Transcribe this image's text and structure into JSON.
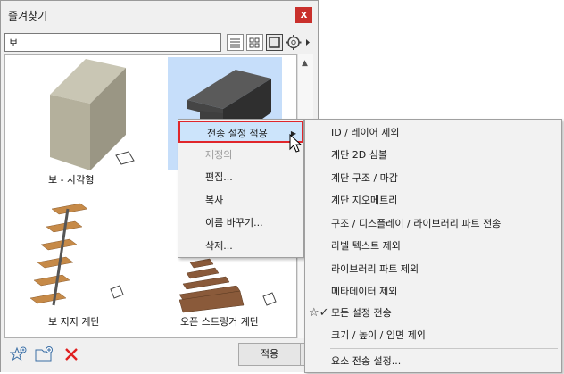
{
  "palette": {
    "title": "즐겨찾기",
    "close_label": "x",
    "search_value": "보",
    "apply_label": "적용",
    "items": [
      {
        "label": "보 - 사각형"
      },
      {
        "label": ""
      },
      {
        "label": "보 지지 계단"
      },
      {
        "label": "오픈 스트링거 계단"
      }
    ]
  },
  "context_menu": {
    "items": [
      {
        "label": "전송 설정 적용",
        "state": "highlighted",
        "submenu": true
      },
      {
        "label": "재정의",
        "state": "disabled"
      },
      {
        "label": "편집..."
      },
      {
        "label": "복사"
      },
      {
        "label": "이름 바꾸기..."
      },
      {
        "label": "삭제..."
      }
    ]
  },
  "submenu": {
    "items": [
      {
        "label": "ID / 레이어 제외"
      },
      {
        "label": "계단 2D 심볼"
      },
      {
        "label": "계단 구조 / 마감"
      },
      {
        "label": "계단 지오메트리"
      },
      {
        "label": "구조 / 디스플레이 / 라이브러리 파트 전송"
      },
      {
        "label": "라벨 텍스트 제외"
      },
      {
        "label": "라이브러리 파트 제외"
      },
      {
        "label": "메타데이터 제외"
      },
      {
        "label": "모든 설정 전송",
        "checked": true
      },
      {
        "label": "크기 / 높이 / 입면 제외"
      },
      {
        "label": "요소 전송 설정..."
      }
    ]
  },
  "colors": {
    "close": "#c9302c",
    "selection": "#c6defa",
    "highlight_border": "#e0262b",
    "delete_icon": "#e02020"
  }
}
